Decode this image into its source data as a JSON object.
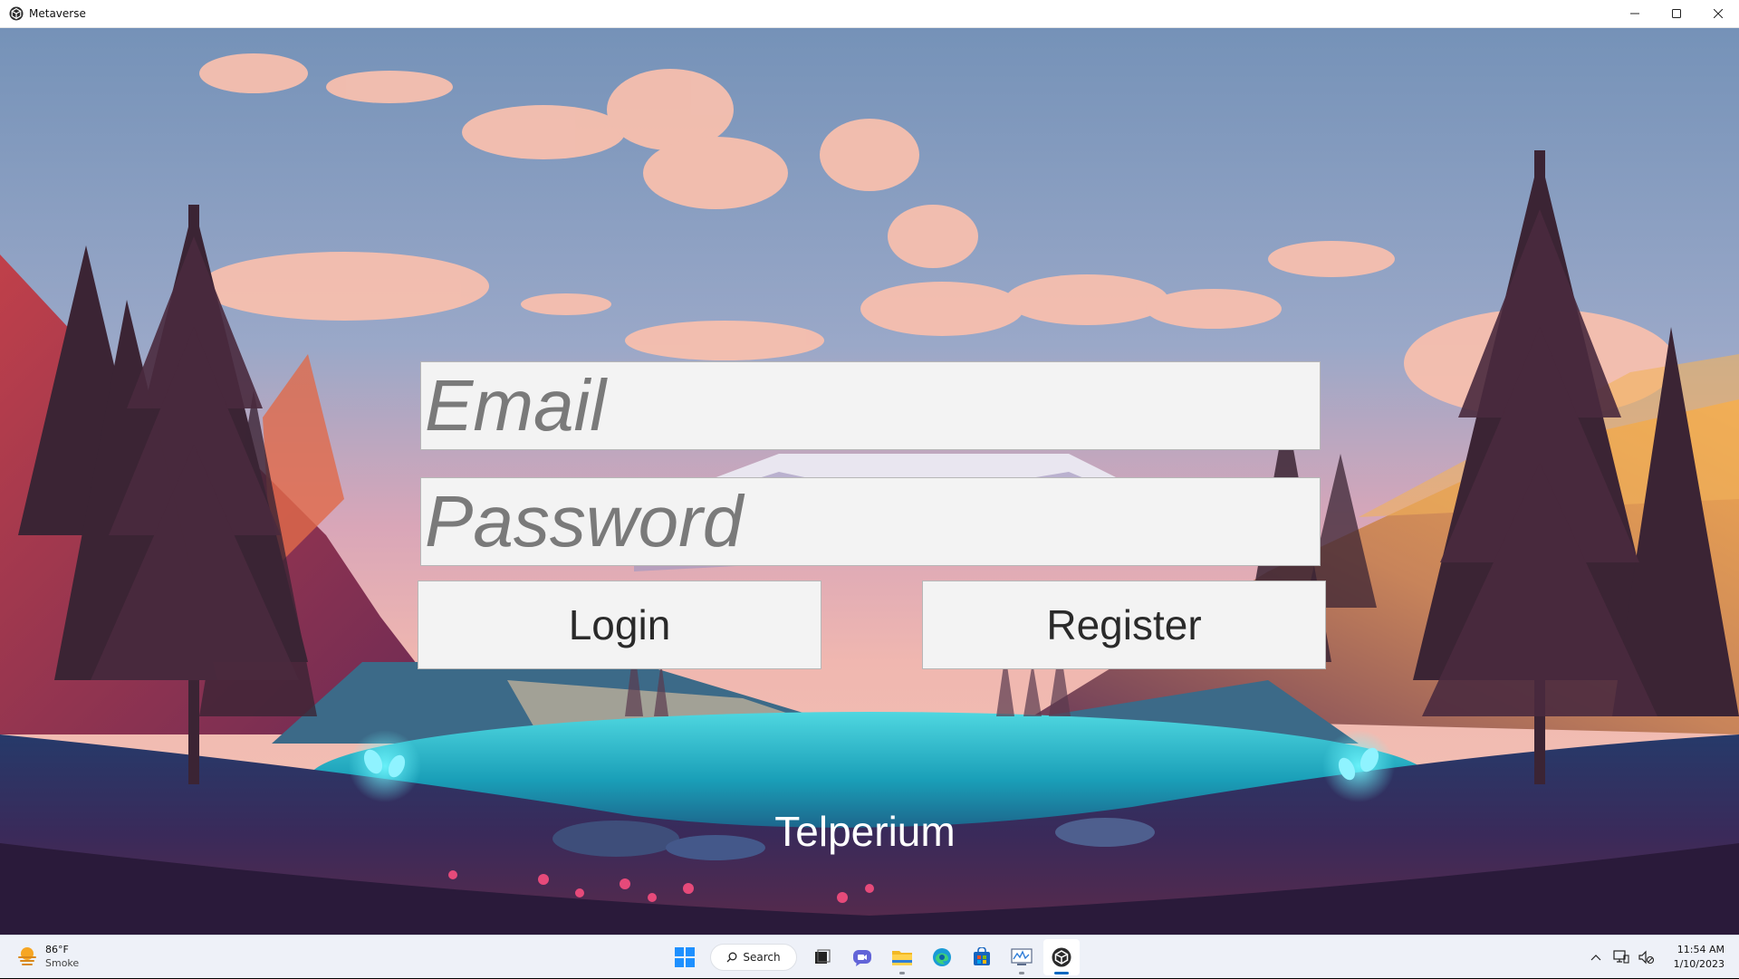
{
  "window": {
    "title": "Metaverse"
  },
  "login_form": {
    "email_placeholder": "Email",
    "password_placeholder": "Password",
    "login_label": "Login",
    "register_label": "Register"
  },
  "brand": {
    "name": "Telperium"
  },
  "taskbar": {
    "weather": {
      "temperature": "86°F",
      "condition": "Smoke"
    },
    "search_label": "Search",
    "pinned_icons": [
      "windows-start-icon",
      "task-view-icon",
      "chat-icon",
      "file-explorer-icon",
      "edge-icon",
      "store-icon",
      "performance-monitor-icon",
      "unity-icon"
    ],
    "clock": {
      "time": "11:54 AM",
      "date": "1/10/2023"
    }
  },
  "colors": {
    "sky_top": "#7c98bd",
    "cloud": "#f5b9a8",
    "field_bg": "#f3f3f3",
    "placeholder_text": "#7a7a7a",
    "lake": "#1fb6c9",
    "taskbar_bg": "#eef1f8"
  }
}
